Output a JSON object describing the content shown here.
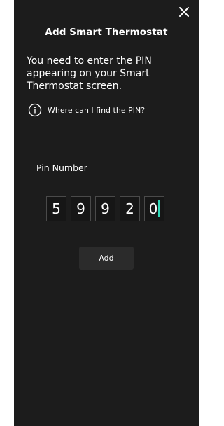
{
  "dialog": {
    "title": "Add Smart Thermostat",
    "instructions": "You need to enter the PIN appearing on your Smart Thermostat screen.",
    "help_link": "Where can I find the PIN?",
    "close_icon": "close-icon",
    "info_icon": "info-icon"
  },
  "pin": {
    "label": "Pin Number",
    "digits": [
      "5",
      "9",
      "9",
      "2",
      "0"
    ],
    "cursor_color": "#2fd8b8"
  },
  "actions": {
    "add_label": "Add"
  },
  "colors": {
    "panel_bg": "#1c1c1c",
    "button_bg": "#2b2b2b",
    "accent": "#2fd8b8"
  }
}
